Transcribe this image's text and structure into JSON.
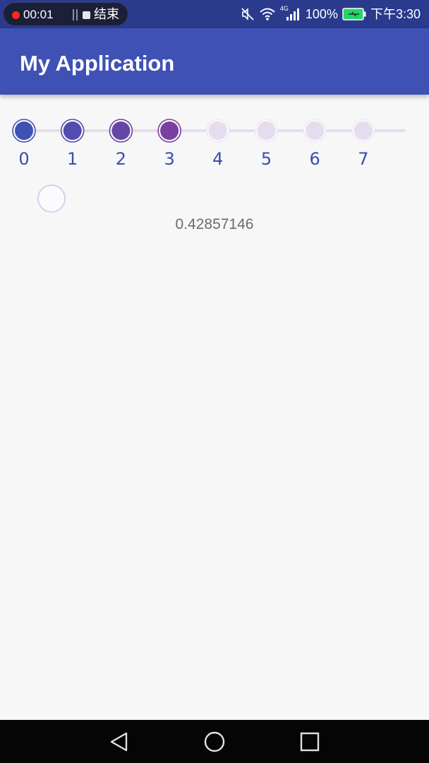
{
  "status_bar": {
    "recording_time": "00:01",
    "recording_end_label": "结束",
    "network_label": "4G",
    "battery_percent": "100%",
    "clock": "下午3:30",
    "icons": [
      "recording-dot-icon",
      "stop-icon",
      "mute-icon",
      "wifi-icon",
      "signal-icon",
      "battery-charging-icon"
    ]
  },
  "app_bar": {
    "title": "My Application",
    "color": "#3f51b5"
  },
  "stepper": {
    "steps": [
      "0",
      "1",
      "2",
      "3",
      "4",
      "5",
      "6",
      "7"
    ],
    "current_step": 3,
    "active_color_start": "#3f51b5",
    "active_color_end": "#7a3fa3",
    "inactive_color": "#e6dcef"
  },
  "progress": {
    "value_text": "0.42857146"
  },
  "nav_bar": {
    "buttons": [
      "back-icon",
      "home-icon",
      "recents-icon"
    ]
  }
}
